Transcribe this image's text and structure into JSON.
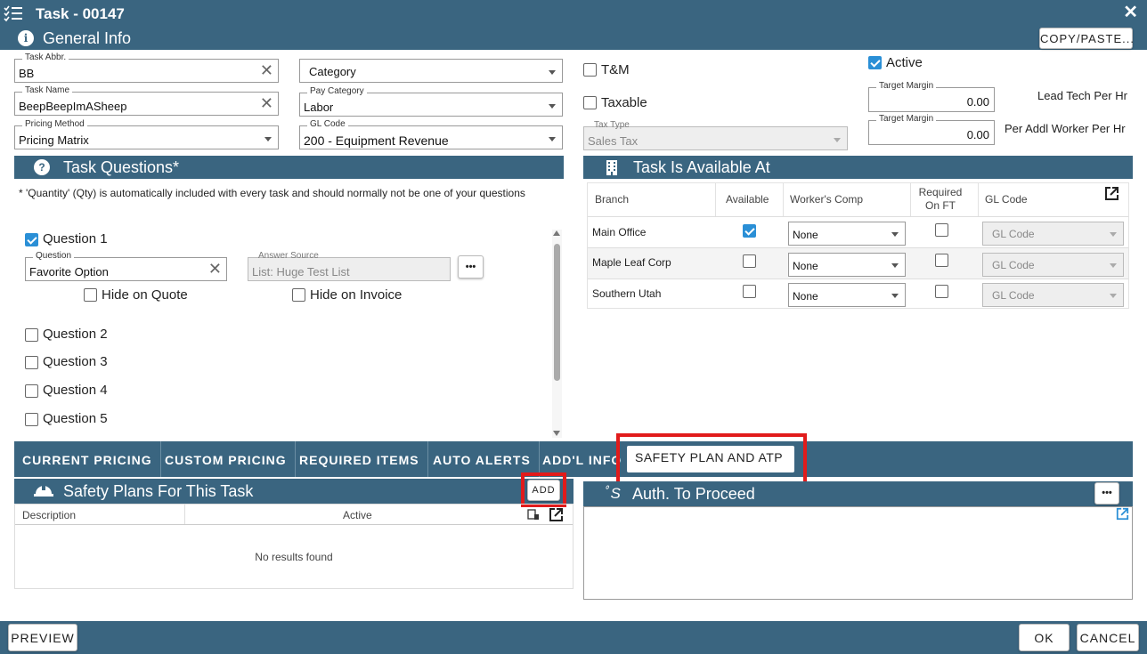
{
  "window": {
    "title": "Task - 00147"
  },
  "general_info": {
    "title": "General Info",
    "copy_paste_label": "COPY/PASTE...",
    "task_abbr": {
      "label": "Task Abbr.",
      "value": "BB"
    },
    "task_name": {
      "label": "Task Name",
      "value": "BeepBeepImASheep"
    },
    "pricing_method": {
      "label": "Pricing Method",
      "value": "Pricing Matrix"
    },
    "category": {
      "placeholder": "Category"
    },
    "pay_category": {
      "label": "Pay Category",
      "value": "Labor"
    },
    "gl_code": {
      "label": "GL Code",
      "value": "200 - Equipment Revenue"
    },
    "tm_label": "T&M",
    "taxable_label": "Taxable",
    "tax_type": {
      "label": "Tax Type",
      "value": "Sales Tax"
    },
    "active_label": "Active",
    "target_margin_1": {
      "label": "Target Margin",
      "value": "0.00"
    },
    "target_margin_2": {
      "label": "Target Margin",
      "value": "0.00"
    },
    "lead_tech_label": "Lead Tech Per Hr",
    "per_addl_label": "Per Addl Worker Per Hr"
  },
  "task_questions": {
    "title": "Task Questions*",
    "note": "* 'Quantity' (Qty) is automatically included with every task and should normally not be one of your questions",
    "q1": {
      "label": "Question 1",
      "question_label": "Question",
      "question_value": "Favorite Option",
      "answer_label": "Answer Source",
      "answer_value": "List: Huge Test List",
      "more": "•••",
      "hide_quote": "Hide on Quote",
      "hide_invoice": "Hide on Invoice"
    },
    "others": [
      "Question 2",
      "Question 3",
      "Question 4",
      "Question 5"
    ]
  },
  "availability": {
    "title": "Task Is Available At",
    "headers": {
      "branch": "Branch",
      "available": "Available",
      "workers_comp": "Worker's Comp",
      "required1": "Required",
      "required2": "On FT",
      "gl_code": "GL Code"
    },
    "rows": [
      {
        "branch": "Main Office",
        "available": true,
        "workers_comp": "None",
        "required": false,
        "gl_code": "GL Code"
      },
      {
        "branch": "Maple Leaf Corp",
        "available": false,
        "workers_comp": "None",
        "required": false,
        "gl_code": "GL Code"
      },
      {
        "branch": "Southern Utah",
        "available": false,
        "workers_comp": "None",
        "required": false,
        "gl_code": "GL Code"
      }
    ]
  },
  "tabs": [
    "CURRENT PRICING",
    "CUSTOM PRICING",
    "REQUIRED ITEMS",
    "AUTO ALERTS",
    "ADD'L INFO",
    "SAFETY PLAN AND ATP"
  ],
  "safety_plans": {
    "title": "Safety Plans For This Task",
    "add_label": "ADD",
    "col_description": "Description",
    "col_active": "Active",
    "empty": "No results found"
  },
  "atp": {
    "title": "Auth. To Proceed",
    "more": "•••"
  },
  "footer": {
    "preview": "PREVIEW",
    "ok": "OK",
    "cancel": "CANCEL"
  },
  "colors": {
    "header": "#3a6580",
    "check": "#2a8fd6",
    "highlight": "#e11b1b"
  }
}
